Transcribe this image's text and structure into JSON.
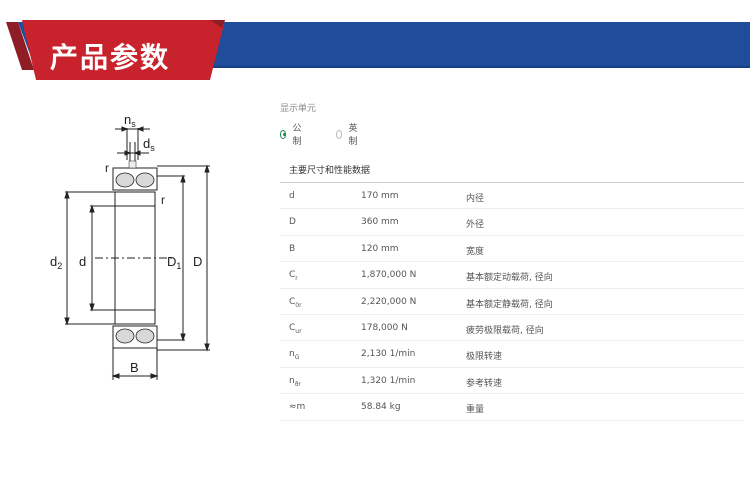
{
  "header": {
    "title": "产品参数"
  },
  "units": {
    "label": "显示单元",
    "options": [
      {
        "label": "公制",
        "selected": true
      },
      {
        "label": "英制",
        "selected": false
      }
    ]
  },
  "drawing": {
    "labels": {
      "ns": "n",
      "ns_sub": "s",
      "ds": "d",
      "ds_sub": "s",
      "r_left": "r",
      "r_right": "r",
      "d2": "d",
      "d2_sub": "2",
      "d": "d",
      "D1": "D",
      "D1_sub": "1",
      "D": "D",
      "B": "B"
    }
  },
  "section": {
    "title": "主要尺寸和性能数据"
  },
  "rows": [
    {
      "sym": "d",
      "sub": "",
      "value": "170 mm",
      "desc": "内径"
    },
    {
      "sym": "D",
      "sub": "",
      "value": "360 mm",
      "desc": "外径"
    },
    {
      "sym": "B",
      "sub": "",
      "value": "120 mm",
      "desc": "宽度"
    },
    {
      "sym": "C",
      "sub": "r",
      "value": "1,870,000 N",
      "desc": "基本额定动载荷, 径向"
    },
    {
      "sym": "C",
      "sub": "0r",
      "value": "2,220,000 N",
      "desc": "基本额定静载荷, 径向"
    },
    {
      "sym": "C",
      "sub": "ur",
      "value": "178,000 N",
      "desc": "疲劳极限载荷, 径向"
    },
    {
      "sym": "n",
      "sub": "G",
      "value": "2,130 1/min",
      "desc": "极限转速"
    },
    {
      "sym": "n",
      "sub": "ϑr",
      "value": "1,320 1/min",
      "desc": "参考转速"
    },
    {
      "sym": "≈m",
      "sub": "",
      "value": "58.84 kg",
      "desc": "重量"
    }
  ]
}
